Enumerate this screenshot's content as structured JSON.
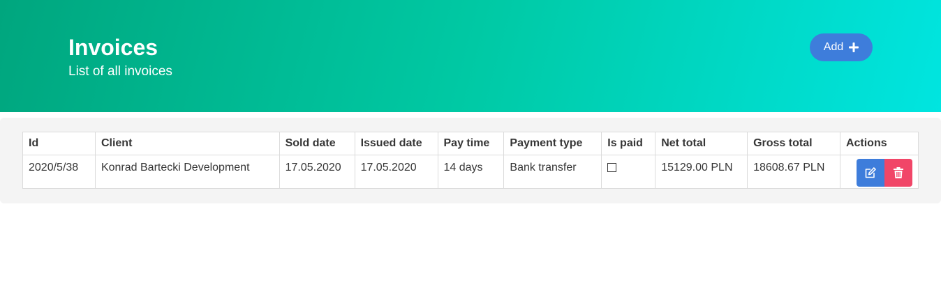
{
  "header": {
    "title": "Invoices",
    "subtitle": "List of all invoices",
    "add_label": "Add"
  },
  "table": {
    "columns": [
      "Id",
      "Client",
      "Sold date",
      "Issued date",
      "Pay time",
      "Payment type",
      "Is paid",
      "Net total",
      "Gross total",
      "Actions"
    ],
    "rows": [
      {
        "id": "2020/5/38",
        "client": "Konrad Bartecki Development",
        "sold_date": "17.05.2020",
        "issued_date": "17.05.2020",
        "pay_time": "14 days",
        "payment_type": "Bank transfer",
        "is_paid": false,
        "net_total": "15129.00 PLN",
        "gross_total": "18608.67 PLN"
      }
    ]
  },
  "icons": {
    "add": "plus-icon",
    "edit": "edit-icon",
    "delete": "trash-icon",
    "paid": "checkbox-icon"
  },
  "colors": {
    "hero_start": "#00a67e",
    "hero_end": "#00e5e0",
    "primary": "#3e7ddb",
    "danger": "#f14668"
  }
}
